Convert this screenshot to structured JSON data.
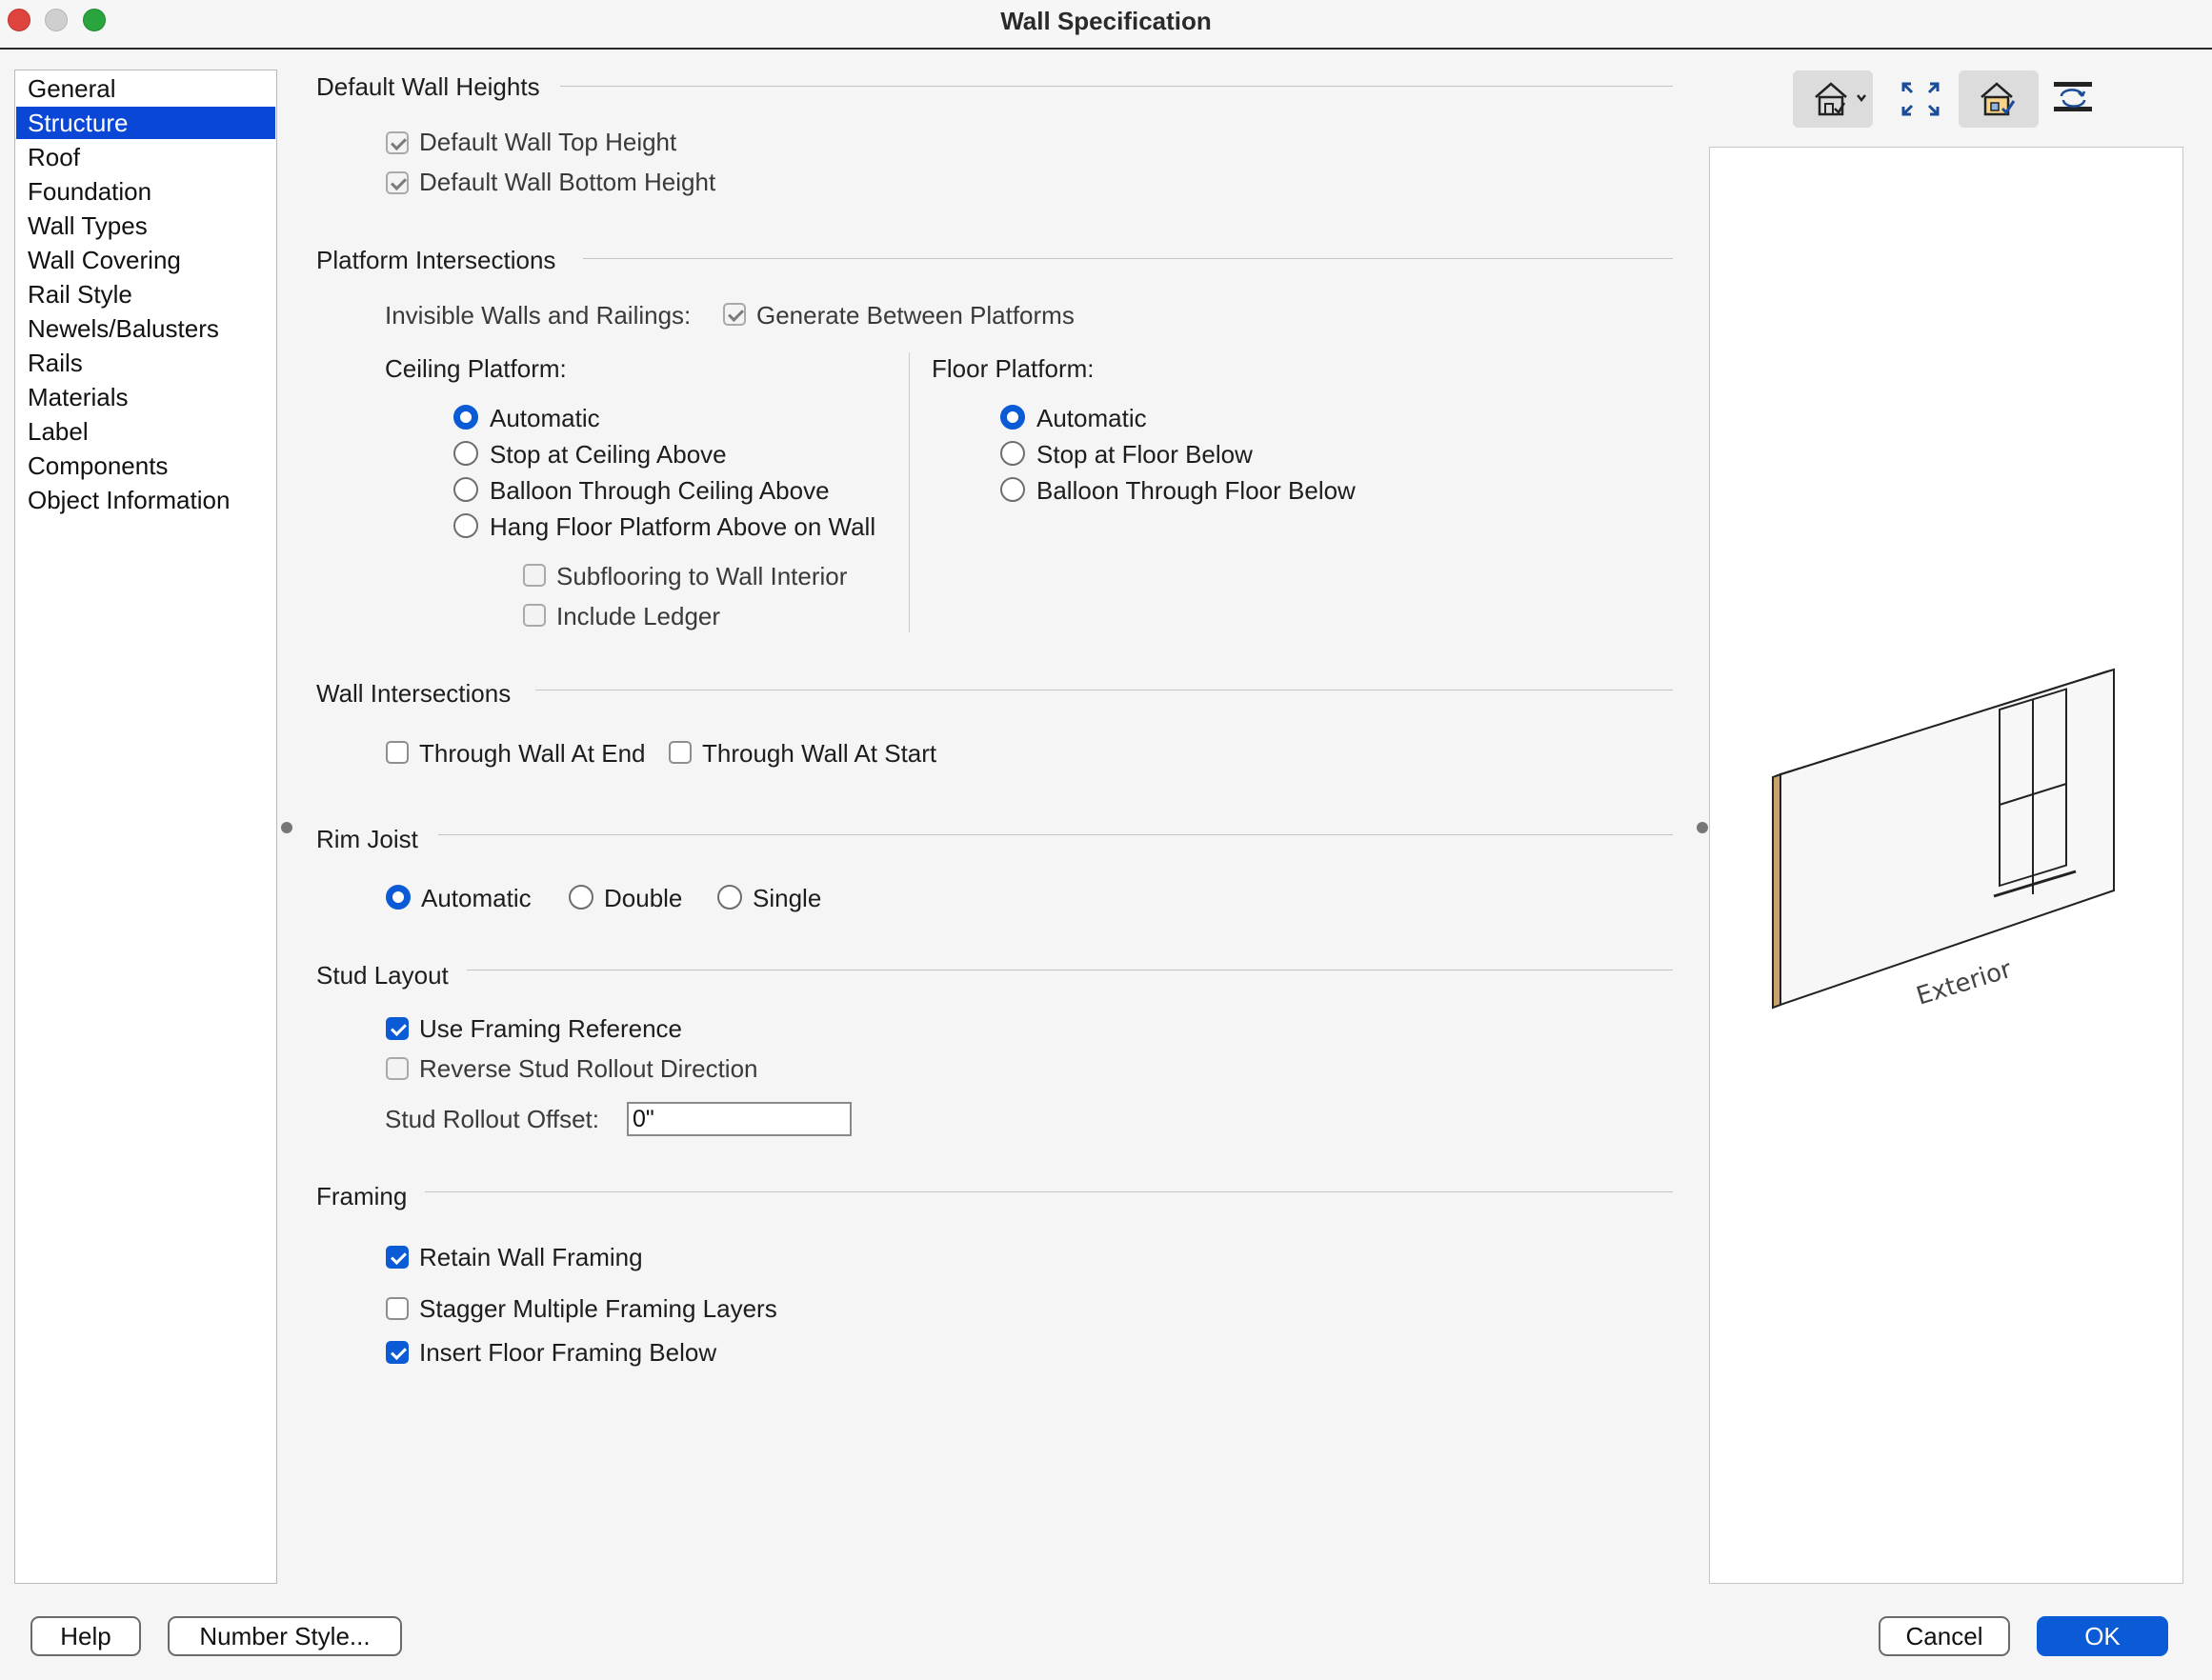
{
  "window": {
    "title": "Wall Specification"
  },
  "categories": [
    {
      "label": "General",
      "selected": false
    },
    {
      "label": "Structure",
      "selected": true
    },
    {
      "label": "Roof",
      "selected": false
    },
    {
      "label": "Foundation",
      "selected": false
    },
    {
      "label": "Wall Types",
      "selected": false
    },
    {
      "label": "Wall Covering",
      "selected": false
    },
    {
      "label": "Rail Style",
      "selected": false
    },
    {
      "label": "Newels/Balusters",
      "selected": false
    },
    {
      "label": "Rails",
      "selected": false
    },
    {
      "label": "Materials",
      "selected": false
    },
    {
      "label": "Label",
      "selected": false
    },
    {
      "label": "Components",
      "selected": false
    },
    {
      "label": "Object Information",
      "selected": false
    }
  ],
  "default_heights": {
    "title": "Default Wall Heights",
    "top_label": "Default Wall Top Height",
    "top_checked": true,
    "bottom_label": "Default Wall Bottom Height",
    "bottom_checked": true
  },
  "platform": {
    "title": "Platform Intersections",
    "invisible_label": "Invisible Walls and Railings:",
    "generate_label": "Generate Between Platforms",
    "generate_checked": true,
    "ceiling_title": "Ceiling Platform:",
    "ceiling_options": [
      "Automatic",
      "Stop at Ceiling Above",
      "Balloon Through Ceiling Above",
      "Hang Floor Platform Above on Wall"
    ],
    "ceiling_selected": "Automatic",
    "subflooring_label": "Subflooring to Wall Interior",
    "subflooring_checked": false,
    "ledger_label": "Include Ledger",
    "ledger_checked": false,
    "floor_title": "Floor Platform:",
    "floor_options": [
      "Automatic",
      "Stop at Floor Below",
      "Balloon Through Floor Below"
    ],
    "floor_selected": "Automatic"
  },
  "wall_intersections": {
    "title": "Wall Intersections",
    "end_label": "Through Wall At End",
    "end_checked": false,
    "start_label": "Through Wall At Start",
    "start_checked": false
  },
  "rim_joist": {
    "title": "Rim Joist",
    "options": [
      "Automatic",
      "Double",
      "Single"
    ],
    "selected": "Automatic"
  },
  "stud_layout": {
    "title": "Stud Layout",
    "framing_ref_label": "Use Framing Reference",
    "framing_ref_checked": true,
    "reverse_label": "Reverse Stud Rollout Direction",
    "reverse_checked": false,
    "offset_label": "Stud Rollout Offset:",
    "offset_value": "0\""
  },
  "framing": {
    "title": "Framing",
    "retain_label": "Retain Wall Framing",
    "retain_checked": true,
    "stagger_label": "Stagger Multiple Framing Layers",
    "stagger_checked": false,
    "floor_below_label": "Insert Floor Framing Below",
    "floor_below_checked": true
  },
  "preview": {
    "exterior_label": "Exterior",
    "toolbar_icons": [
      "preview-view-options-icon",
      "fill-window-icon",
      "display-preview-icon",
      "rotate-preview-icon"
    ]
  },
  "footer": {
    "help_label": "Help",
    "number_style_label": "Number Style...",
    "cancel_label": "Cancel",
    "ok_label": "OK"
  },
  "colors": {
    "accent": "#0b5bd7",
    "selection": "#0a47d6",
    "close": "#e0443e",
    "zoom": "#2aa43d",
    "minimize": "#c8c8c8"
  }
}
